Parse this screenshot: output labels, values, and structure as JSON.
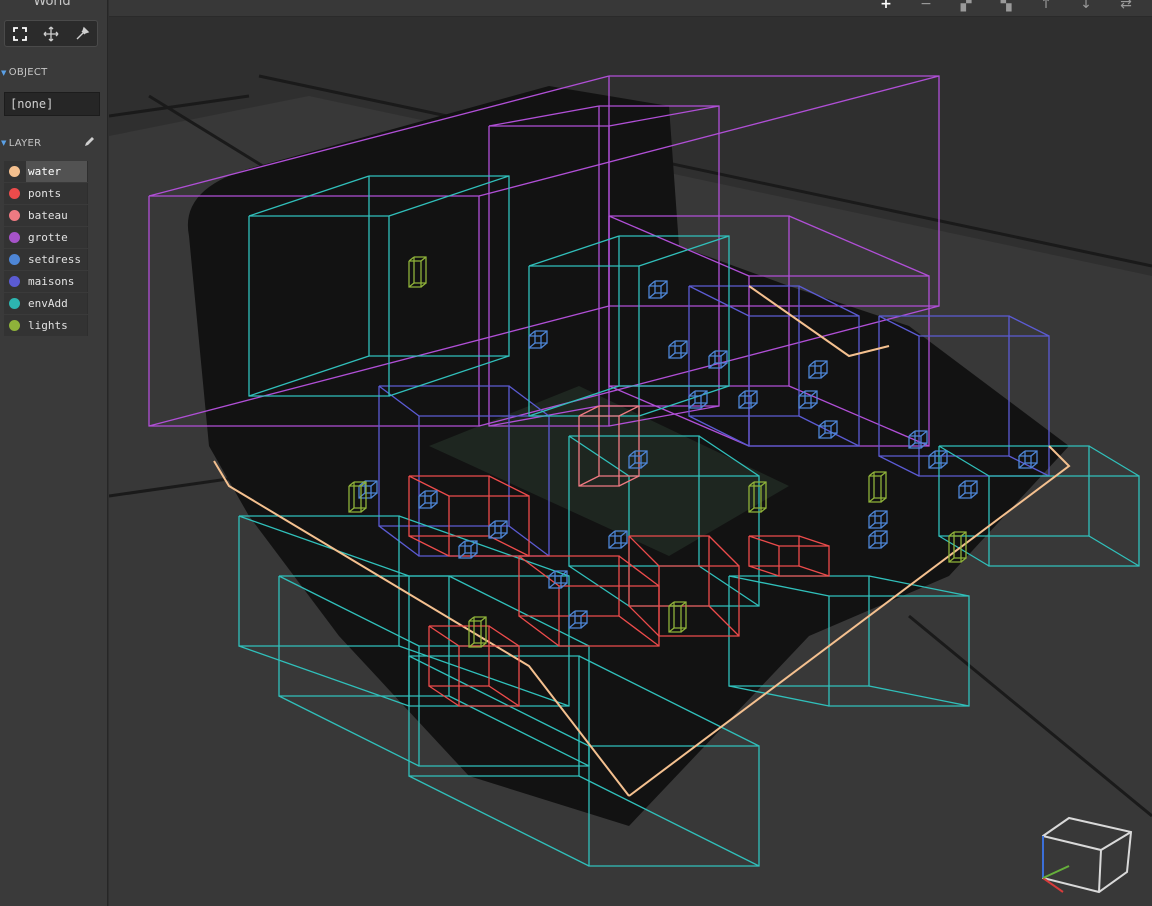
{
  "sidebar": {
    "world_title": "World",
    "tools": [
      {
        "name": "select-frame-tool",
        "icon": "frame-select-icon",
        "active": true
      },
      {
        "name": "move-tool",
        "icon": "move-arrows-icon",
        "active": false
      },
      {
        "name": "pick-tool",
        "icon": "eyedropper-icon",
        "active": false
      }
    ],
    "object_section": {
      "label": "OBJECT",
      "value": "[none]"
    },
    "layer_section": {
      "label": "LAYER",
      "edit_icon": "pencil-icon",
      "layers": [
        {
          "name": "water",
          "color": "#f4c08f",
          "selected": true
        },
        {
          "name": "ponts",
          "color": "#ec4b4b",
          "selected": false
        },
        {
          "name": "bateau",
          "color": "#ef7a82",
          "selected": false
        },
        {
          "name": "grotte",
          "color": "#a653c9",
          "selected": false
        },
        {
          "name": "setdress",
          "color": "#4e86d6",
          "selected": false
        },
        {
          "name": "maisons",
          "color": "#5b5bd3",
          "selected": false
        },
        {
          "name": "envAdd",
          "color": "#2db5b0",
          "selected": false
        },
        {
          "name": "lights",
          "color": "#8fb23a",
          "selected": false
        }
      ]
    }
  },
  "toolbar": {
    "buttons": [
      {
        "name": "zoom-in-button",
        "icon": "plus-icon",
        "glyph": "+"
      },
      {
        "name": "zoom-out-button",
        "icon": "minus-icon",
        "glyph": "−"
      },
      {
        "name": "checker-left-button",
        "icon": "checker-icon",
        "glyph": "▞"
      },
      {
        "name": "checker-right-button",
        "icon": "checker-icon",
        "glyph": "▚"
      },
      {
        "name": "arrow-up-button",
        "icon": "arrow-up-icon",
        "glyph": "↑"
      },
      {
        "name": "arrow-down-button",
        "icon": "arrow-down-icon",
        "glyph": "↓"
      },
      {
        "name": "swap-button",
        "icon": "swap-arrows-icon",
        "glyph": "⇄"
      }
    ]
  },
  "viewport": {
    "content": "3d-scene-bounding-boxes",
    "orientation_gizmo": "view-cube-icon"
  }
}
